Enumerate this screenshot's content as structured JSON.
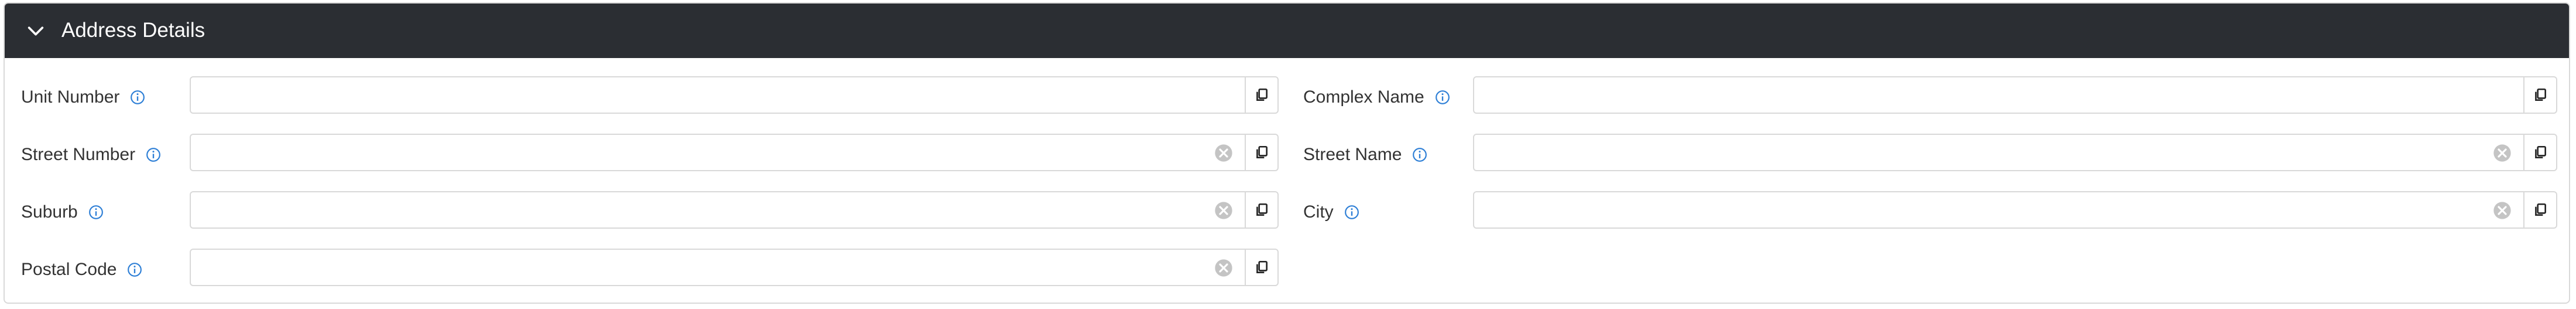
{
  "section": {
    "title": "Address Details",
    "collapse_icon": "chevron-down-icon"
  },
  "fields": {
    "unit_number": {
      "label": "Unit Number",
      "value": "",
      "clearable": false
    },
    "complex_name": {
      "label": "Complex Name",
      "value": "",
      "clearable": false
    },
    "street_number": {
      "label": "Street Number",
      "value": "",
      "clearable": true
    },
    "street_name": {
      "label": "Street Name",
      "value": "",
      "clearable": true
    },
    "suburb": {
      "label": "Suburb",
      "value": "",
      "clearable": true
    },
    "city": {
      "label": "City",
      "value": "",
      "clearable": true
    },
    "postal_code": {
      "label": "Postal Code",
      "value": "",
      "clearable": true
    }
  },
  "colors": {
    "header_bg": "#2b2e33",
    "info_icon": "#2e7fd6",
    "border": "#d9d9d9"
  }
}
